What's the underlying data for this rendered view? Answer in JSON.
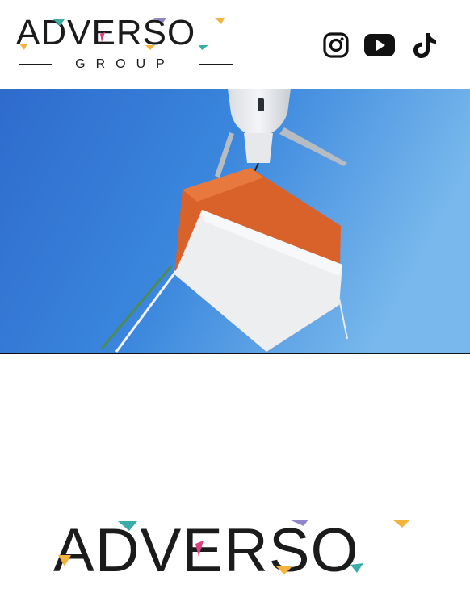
{
  "header": {
    "logo": {
      "name": "ADVERSO",
      "tagline": "GROUP"
    },
    "social": [
      {
        "name": "Instagram",
        "icon": "instagram-icon"
      },
      {
        "name": "YouTube",
        "icon": "youtube-icon"
      },
      {
        "name": "TikTok",
        "icon": "tiktok-icon"
      }
    ]
  },
  "hero": {
    "image": "helicopter-lifting-container-photo"
  },
  "footer_logo": {
    "name": "ADVERSO"
  },
  "colors": {
    "text": "#1b1b1b",
    "accent_teal": "#3aaea6",
    "accent_purple": "#8f86c8",
    "accent_yellow": "#f4b43c",
    "accent_pink": "#e0407a",
    "sky": "#3a84dc",
    "container_orange": "#d9622b"
  }
}
